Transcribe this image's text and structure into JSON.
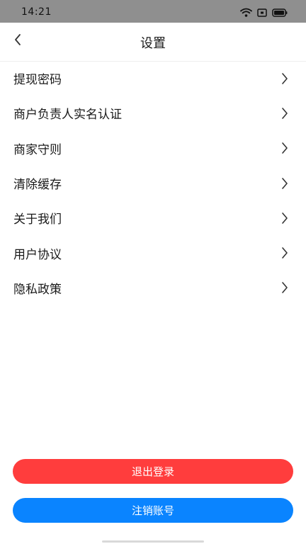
{
  "status_bar": {
    "time": "14:21",
    "icons": [
      "wifi-icon",
      "sim-icon",
      "battery-icon"
    ]
  },
  "header": {
    "title": "设置",
    "back_icon": "chevron-left-icon"
  },
  "menu": {
    "items": [
      {
        "label": "提现密码"
      },
      {
        "label": "商户负责人实名认证"
      },
      {
        "label": "商家守则"
      },
      {
        "label": "清除缓存"
      },
      {
        "label": "关于我们"
      },
      {
        "label": "用户协议"
      },
      {
        "label": "隐私政策"
      }
    ],
    "chevron_icon": "chevron-right-icon"
  },
  "actions": {
    "logout_label": "退出登录",
    "cancel_account_label": "注销账号"
  },
  "colors": {
    "logout": "#ff3d3d",
    "cancel_account": "#0a84ff",
    "status_bar": "#8f8f8f"
  }
}
